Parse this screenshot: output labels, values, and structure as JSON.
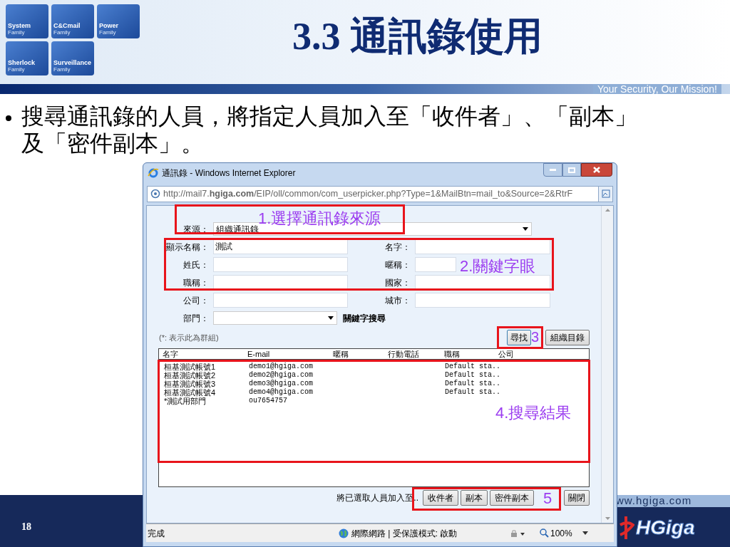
{
  "slide": {
    "title": "3.3 通訊錄使用",
    "slogan": "Your Security, Our Mission!",
    "bullet": "搜尋通訊錄的人員，將指定人員加入至「收件者」、「副本」及「密件副本」。",
    "page_number": "18",
    "website": "ww.hgiga.com",
    "logo": "HGiga",
    "tiles": [
      {
        "name": "System",
        "sub": "Family"
      },
      {
        "name": "C&Cmail",
        "sub": "Family"
      },
      {
        "name": "Power",
        "sub": "Family"
      },
      {
        "name": "Sherlock",
        "sub": "Family"
      },
      {
        "name": "Surveillance",
        "sub": "Family"
      }
    ]
  },
  "window": {
    "title": "通訊錄 - Windows Internet Explorer",
    "url": "http://mail7.**hgiga.com**/EIP/oll/common/com_userpicker.php?Type=1&MailBtn=mail_to&Source=2&RtrF",
    "source": {
      "label": "來源：",
      "value": "組織通訊錄"
    },
    "fields": [
      {
        "left": {
          "label": "顯示名稱：",
          "value": "測試"
        },
        "right": {
          "label": "名字："
        }
      },
      {
        "left": {
          "label": "姓氏："
        },
        "right": {
          "label": "暱稱："
        }
      },
      {
        "left": {
          "label": "職稱："
        },
        "right": {
          "label": "國家："
        }
      },
      {
        "left": {
          "label": "公司："
        },
        "right": {
          "label": "城市："
        }
      }
    ],
    "department": {
      "label": "部門：",
      "keyword_search": "關鍵字搜尋"
    },
    "note": "(*: 表示此為群組)",
    "search_button": "尋找",
    "directory_button": "組織目錄",
    "columns": [
      "名字",
      "E-mail",
      "暱稱",
      "行動電話",
      "職稱",
      "公司"
    ],
    "rows": [
      {
        "name": "桓基測試帳號1",
        "email": "demo1@hgiga.com",
        "title": "Default sta.."
      },
      {
        "name": "桓基測試帳號2",
        "email": "demo2@hgiga.com",
        "title": "Default sta.."
      },
      {
        "name": "桓基測試帳號3",
        "email": "demo3@hgiga.com",
        "title": "Default sta.."
      },
      {
        "name": "桓基測試帳號4",
        "email": "demo4@hgiga.com",
        "title": "Default sta.."
      },
      {
        "name": "*測試用部門",
        "email": "ou7654757"
      }
    ],
    "add_label": "將已選取人員加入至..",
    "add_buttons": [
      "收件者",
      "副本",
      "密件副本"
    ],
    "close_button": "關閉",
    "status": {
      "text": "完成",
      "zone": "網際網路 | 受保護模式: 啟動",
      "zoom": "100%"
    }
  },
  "annotations": [
    {
      "label": "1.選擇通訊錄來源"
    },
    {
      "label": "2.關鍵字眼"
    },
    {
      "label": "3"
    },
    {
      "label": "4.搜尋結果"
    },
    {
      "label": "5"
    }
  ]
}
